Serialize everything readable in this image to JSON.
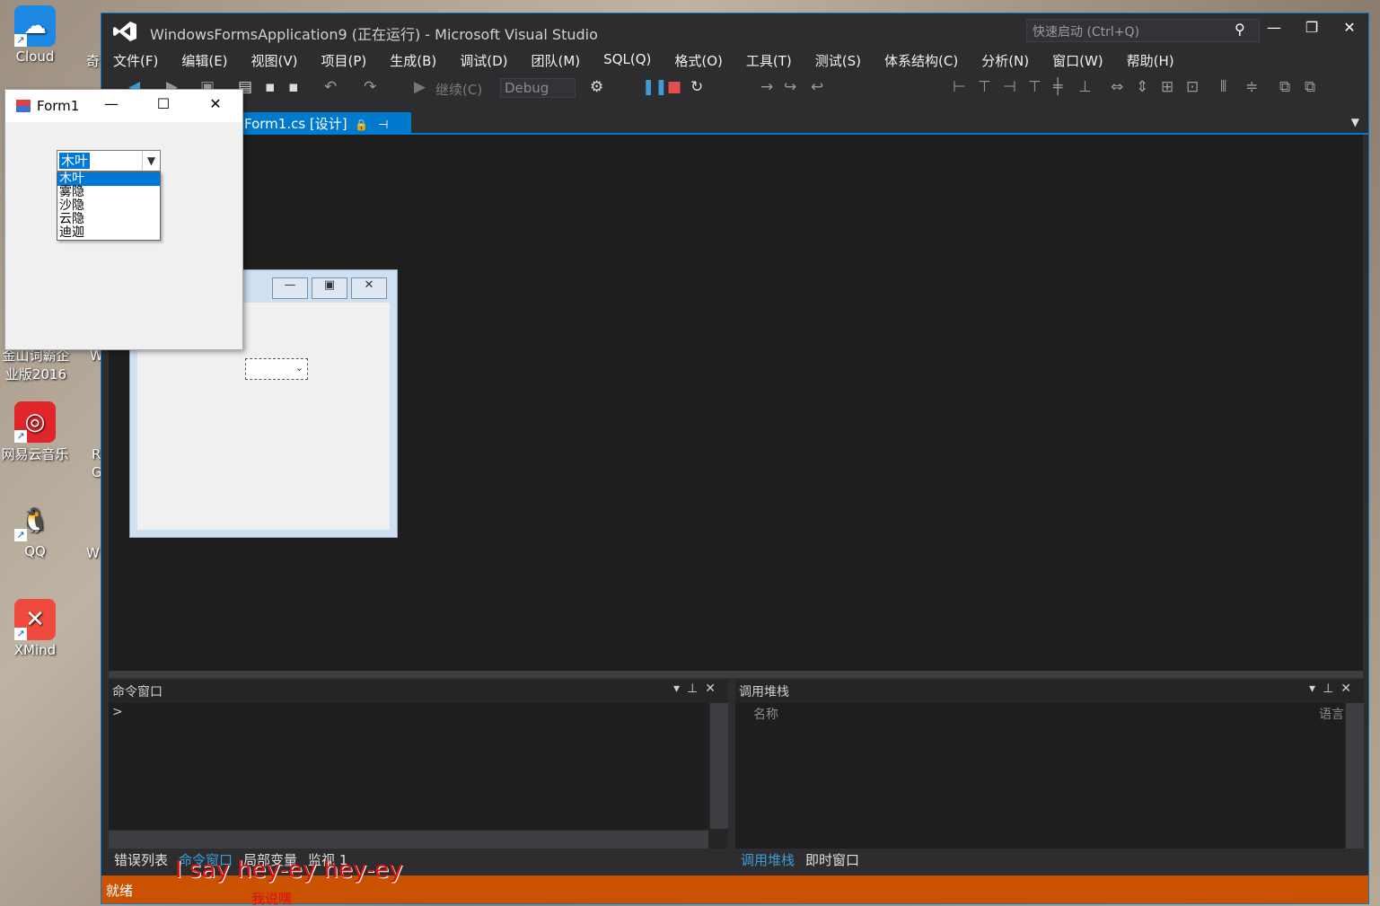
{
  "desktop": {
    "icons": [
      {
        "label": "Cloud",
        "icon": "cloud-icon"
      },
      {
        "label": "金山词霸企业版2016",
        "icon": "jinshan-icon"
      },
      {
        "label": "网易云音乐",
        "icon": "netease-music-icon"
      },
      {
        "label": "QQ",
        "icon": "qq-penguin-icon"
      },
      {
        "label": "XMind",
        "icon": "xmind-icon"
      }
    ],
    "edge_text": [
      "奇",
      "W",
      "R",
      "G",
      "W"
    ]
  },
  "vs": {
    "title": "WindowsFormsApplication9 (正在运行) - Microsoft Visual Studio",
    "quick_launch_placeholder": "快速启动 (Ctrl+Q)",
    "menu": [
      "文件(F)",
      "编辑(E)",
      "视图(V)",
      "项目(P)",
      "生成(B)",
      "调试(D)",
      "团队(M)",
      "SQL(Q)",
      "格式(O)",
      "工具(T)",
      "测试(S)",
      "体系结构(C)",
      "分析(N)",
      "窗口(W)",
      "帮助(H)"
    ],
    "toolbar": {
      "continue_label": "继续(C)",
      "config": "Debug"
    },
    "doc_tab": "Form1.cs [设计]",
    "command_pane": {
      "title": "命令窗口",
      "prompt": ">"
    },
    "callstack_pane": {
      "title": "调用堆栈",
      "col_name": "名称",
      "col_lang": "语言"
    },
    "left_tabs": [
      "错误列表",
      "命令窗口",
      "局部变量",
      "监视 1"
    ],
    "right_tabs": [
      "调用堆栈",
      "即时窗口"
    ],
    "status": "就绪",
    "accent": "#007acc",
    "status_color": "#ca5100"
  },
  "form1": {
    "title": "Form1",
    "combo_value": "木叶",
    "options": [
      "木叶",
      "雾隐",
      "沙隐",
      "云隐",
      "迪迦"
    ],
    "selected_index": 0
  },
  "overlay": {
    "lyric": "I say hey-ey hey-ey",
    "lyric2": "我说嘿"
  }
}
